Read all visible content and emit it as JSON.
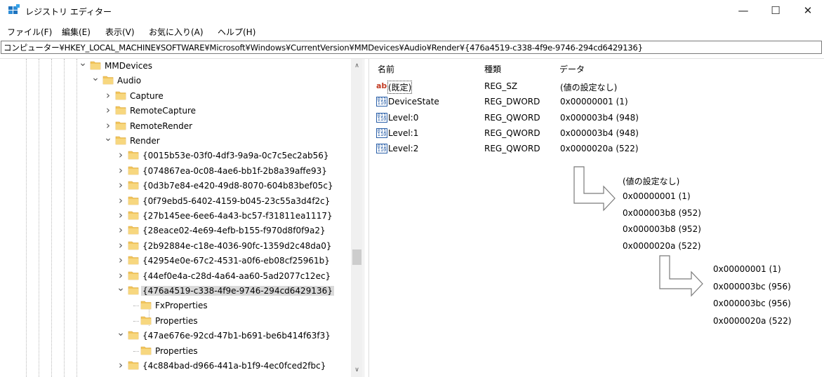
{
  "window": {
    "title": "レジストリ エディター",
    "minimize": "—",
    "maximize": "☐",
    "close": "✕"
  },
  "menu": [
    "ファイル(F)",
    "編集(E)",
    "表示(V)",
    "お気に入り(A)",
    "ヘルプ(H)"
  ],
  "address": "コンピューター¥HKEY_LOCAL_MACHINE¥SOFTWARE¥Microsoft¥Windows¥CurrentVersion¥MMDevices¥Audio¥Render¥{476a4519-c338-4f9e-9746-294cd6429136}",
  "tree": {
    "items": [
      {
        "label": "MMDevices",
        "expander": "v"
      },
      {
        "label": "Audio",
        "expander": "v"
      },
      {
        "label": "Capture",
        "expander": ">"
      },
      {
        "label": "RemoteCapture",
        "expander": ">"
      },
      {
        "label": "RemoteRender",
        "expander": ">"
      },
      {
        "label": "Render",
        "expander": "v"
      },
      {
        "label": "{0015b53e-03f0-4df3-9a9a-0c7c5ec2ab56}",
        "expander": ">"
      },
      {
        "label": "{074867ea-0c08-4ae6-bb1f-2b8a39affe93}",
        "expander": ">"
      },
      {
        "label": "{0d3b7e84-e420-49d8-8070-604b83bef05c}",
        "expander": ">"
      },
      {
        "label": "{0f79ebd5-6402-4159-b045-23c55a3d4f2c}",
        "expander": ">"
      },
      {
        "label": "{27b145ee-6ee6-4a43-bc57-f31811ea1117}",
        "expander": ">"
      },
      {
        "label": "{28eace02-4e69-4efb-b155-f970d8f0f9a2}",
        "expander": ">"
      },
      {
        "label": "{2b92884e-c18e-4036-90fc-1359d2c48da0}",
        "expander": ">"
      },
      {
        "label": "{42954e0e-67c2-4531-a0f6-eb08cf25961b}",
        "expander": ">"
      },
      {
        "label": "{44ef0e4a-c28d-4a64-aa60-5ad2077c12ec}",
        "expander": ">"
      },
      {
        "label": "{476a4519-c338-4f9e-9746-294cd6429136}",
        "expander": "v"
      },
      {
        "label": "FxProperties",
        "expander": ""
      },
      {
        "label": "Properties",
        "expander": ""
      },
      {
        "label": "{47ae676e-92cd-47b1-b691-be6b414f63f3}",
        "expander": "v"
      },
      {
        "label": "Properties",
        "expander": ""
      },
      {
        "label": "{4c884bad-d966-441a-b1f9-4ec0fced2fbc}",
        "expander": ">"
      }
    ]
  },
  "scrollbar": {
    "up": "∧",
    "down": "∨"
  },
  "list": {
    "columns": [
      "名前",
      "種類",
      "データ"
    ],
    "rows": [
      {
        "icon": "string-value-icon",
        "glyph": "ab",
        "name": "(既定)",
        "type": "REG_SZ",
        "data": "(値の設定なし)"
      },
      {
        "icon": "binary-value-icon",
        "glyph": "011 110",
        "name": "DeviceState",
        "type": "REG_DWORD",
        "data": "0x00000001 (1)"
      },
      {
        "icon": "binary-value-icon",
        "glyph": "011 110",
        "name": "Level:0",
        "type": "REG_QWORD",
        "data": "0x000003b4 (948)"
      },
      {
        "icon": "binary-value-icon",
        "glyph": "011 110",
        "name": "Level:1",
        "type": "REG_QWORD",
        "data": "0x000003b4 (948)"
      },
      {
        "icon": "binary-value-icon",
        "glyph": "011 110",
        "name": "Level:2",
        "type": "REG_QWORD",
        "data": "0x0000020a (522)"
      }
    ]
  },
  "annotations": {
    "step1": [
      "(値の設定なし)",
      "0x00000001 (1)",
      "0x000003b8 (952)",
      "0x000003b8 (952)",
      "0x0000020a (522)"
    ],
    "step2": [
      "0x00000001 (1)",
      "0x000003bc (956)",
      "0x000003bc (956)",
      "0x0000020a (522)"
    ]
  },
  "colors": {
    "folder": "#f2c55c",
    "selection": "#d9d9d9",
    "icon_blue": "#2a5fa8",
    "icon_red": "#c23b22"
  }
}
